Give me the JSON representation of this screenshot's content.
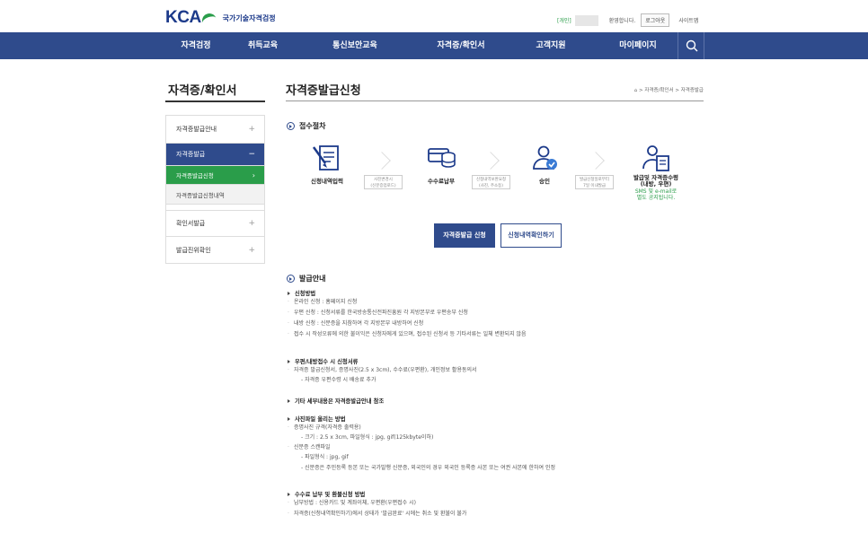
{
  "header": {
    "logo_text": "KCA",
    "org_name": "국가기술자격검정",
    "user_name": "[개인]",
    "greeting": "환영합니다.",
    "logout_label": "로그아웃",
    "sitemap_label": "사이트맵"
  },
  "nav": {
    "items": [
      "자격검정",
      "취득교육",
      "통신보안교육",
      "자격증/확인서",
      "고객지원",
      "마이페이지"
    ]
  },
  "sidebar": {
    "title": "자격증/확인서",
    "items": [
      {
        "label": "자격증발급안내",
        "marker": "+"
      },
      {
        "label": "자격증발급",
        "marker": "−"
      },
      {
        "label": "확인서발급",
        "marker": "+"
      },
      {
        "label": "발급진위확인",
        "marker": "+"
      }
    ],
    "subitems": [
      {
        "label": "자격증발급신청",
        "marker": "›"
      },
      {
        "label": "자격증발급신청내역"
      }
    ]
  },
  "main": {
    "title": "자격증발급신청",
    "breadcrumb": "⌂ > 자격증/확인서 > 자격증발급",
    "section1": "접수절차",
    "steps": [
      "신청내역입력",
      "수수료납부",
      "승인",
      "발급및 자격증수령\n(내방, 우편)"
    ],
    "step_note": "SMS 및 e-mail로\n별도 공지됩니다.",
    "step_boxes": [
      "사진변경시\n(신분증업로드)",
      "신청내역보완요청\n(사진, 주소등)",
      "발급신청일로부터\n7일 이내발급"
    ],
    "apply_button": "자격증발급 신청",
    "history_button": "신청내역확인하기",
    "section2": "발급안내",
    "groups": [
      {
        "title": "신청방법",
        "lines": [
          {
            "t": "li",
            "v": "온라인 신청 : 홈페이지 신청"
          },
          {
            "t": "li",
            "v": "우편 신청 : 신청서류를 한국방송통신전파진흥원 각 지방본부로 우편송부 신청"
          },
          {
            "t": "li",
            "v": "내방 신청 : 신분증을 지참하여 각 지방본부 내방하여 신청"
          },
          {
            "t": "li",
            "v": "접수 시 작성오류에 의한 불이익은 신청자에게 있으며, 접수된 신청서 등 기타서류는 일체 변환되지 않음"
          }
        ]
      },
      {
        "title": "우편/내방접수 시 신청서류",
        "lines": [
          {
            "t": "li",
            "v": "자격증 발급신청서, 증명사진(2.5 x 3cm), 수수료(우편환), 개인정보 활용동의서"
          },
          {
            "t": "d",
            "v": "- 자격증 우편수령 시 배송료 추가"
          }
        ]
      },
      {
        "title": "기타 세부내용은 자격증발급안내 참조",
        "lines": []
      },
      {
        "title": "사진파일 올리는 방법",
        "lines": [
          {
            "t": "li",
            "v": "증명사진 규격(자격증 출력용)"
          },
          {
            "t": "d",
            "v": "- 크기 : 2.5 x 3cm, 파일형식 : jpg, gif(125kbyte이하)"
          },
          {
            "t": "li",
            "v": "신분증 스캔파일"
          },
          {
            "t": "d",
            "v": "- 파일형식 : jpg, gif"
          },
          {
            "t": "d",
            "v": "- 신분증은 주민등록 등본 또는 국가발행 신분증, 외국인의 경우 외국인 등록증 사본 또는 여권 사본에 한하여 인정"
          }
        ]
      },
      {
        "title": "수수료 납부 및 환불신청 방법",
        "lines": [
          {
            "t": "li",
            "v": "납부방법 : 신용카드 및 계좌이체, 우편환(우편접수 시)"
          },
          {
            "t": "li",
            "v": "자격증(신청내역확인하기)에서 상태가 '발급완료' 시에는 취소 및 환불이 불가"
          }
        ]
      }
    ]
  },
  "colors": {
    "nav": "#2f4b8c",
    "green": "#2a9d4a"
  }
}
